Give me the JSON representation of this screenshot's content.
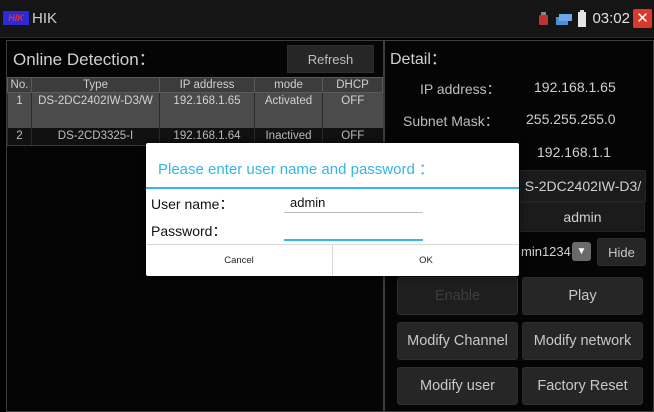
{
  "app": {
    "logo": "HIK",
    "title": "HIK"
  },
  "status": {
    "time": "03:02",
    "icons": [
      "alarm-icon",
      "network-icon",
      "battery-icon"
    ],
    "close_icon": "close-icon"
  },
  "left": {
    "title": "Online Detection：",
    "refresh_label": "Refresh",
    "columns": [
      "No.",
      "Type",
      "IP address",
      "mode",
      "DHCP"
    ],
    "rows": [
      {
        "no": "1",
        "type": "DS-2DC2402IW-D3/W",
        "ip": "192.168.1.65",
        "mode": "Activated",
        "dhcp": "OFF",
        "selected": true
      },
      {
        "no": "2",
        "type": "DS-2CD3325-I",
        "ip": "192.168.1.64",
        "mode": "Inactived",
        "dhcp": "OFF",
        "selected": false
      }
    ]
  },
  "detail": {
    "title": "Detail：",
    "ip_label": "IP address：",
    "ip_value": "192.168.1.65",
    "mask_label": "Subnet Mask：",
    "mask_value": "255.255.255.0",
    "gateway_value": "192.168.1.1",
    "model_value": "S-2DC2402IW-D3/",
    "username_value": "admin",
    "password_value": "min1234",
    "hide_label": "Hide",
    "enable_label": "Enable",
    "play_label": "Play",
    "modify_channel_label": "Modify Channel",
    "modify_network_label": "Modify network",
    "modify_user_label": "Modify user",
    "factory_reset_label": "Factory Reset"
  },
  "dialog": {
    "title": "Please enter user name and password ：",
    "username_label": "User name：",
    "username_value": "admin",
    "password_label": "Password：",
    "password_value": "",
    "cancel_label": "Cancel",
    "ok_label": "OK"
  },
  "colors": {
    "accent": "#33b5e5",
    "close": "#d8392b",
    "logo_bg": "#2a2ad8",
    "logo_fg": "#e03030"
  }
}
